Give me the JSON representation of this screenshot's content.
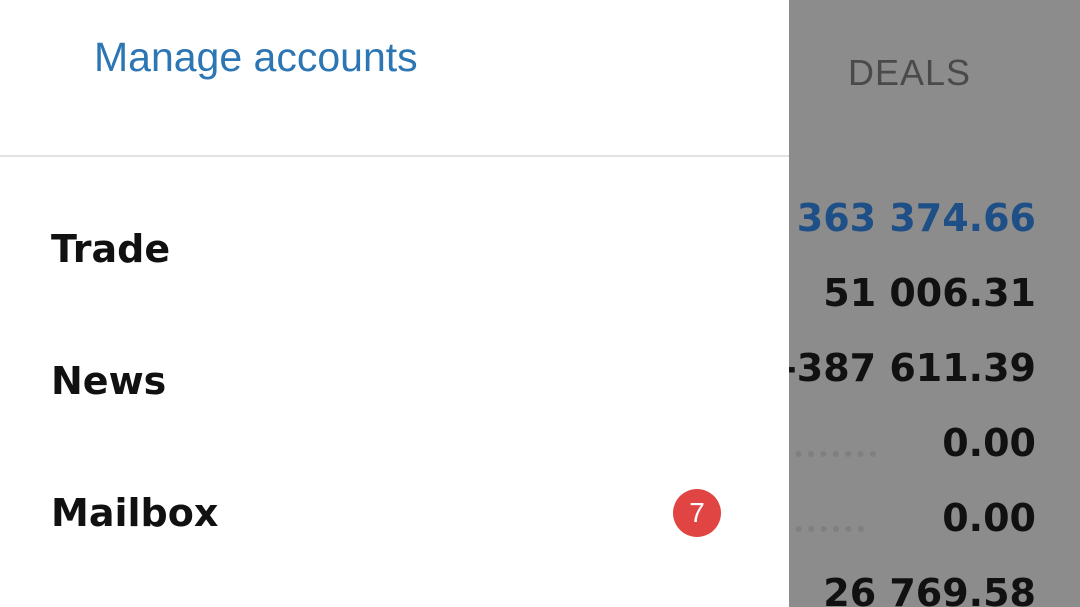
{
  "drawer": {
    "header": {
      "manage_accounts": "Manage accounts"
    },
    "menu": [
      {
        "label": "Trade"
      },
      {
        "label": "News"
      },
      {
        "label": "Mailbox",
        "badge": "7"
      }
    ]
  },
  "background": {
    "tab_label": "DEALS",
    "values": [
      "363 374.66",
      "51 006.31",
      "-387 611.39",
      "0.00",
      "0.00",
      "26 769.58"
    ]
  },
  "colors": {
    "link": "#2d76b4",
    "badge": "#e04443",
    "highlight_value": "#1e4f86",
    "scrim": "#8c8c8c"
  }
}
